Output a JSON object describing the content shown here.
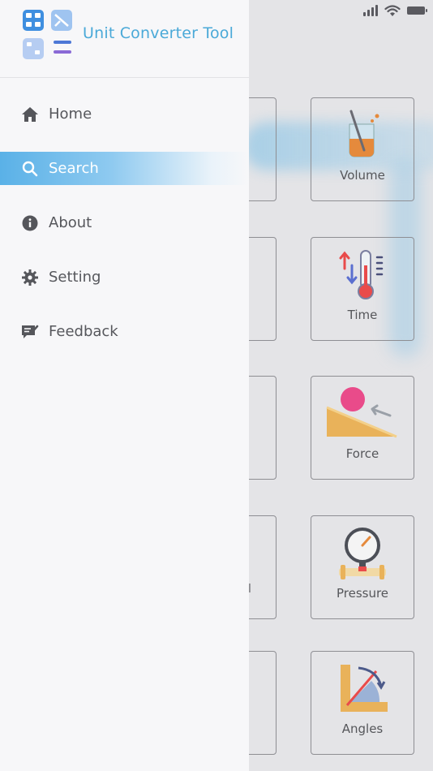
{
  "app": {
    "title": "Unit Converter Tool",
    "accent_color": "#4aa9d8",
    "logo_icon": "app-grid-logo-icon"
  },
  "menu": {
    "items": [
      {
        "id": "home",
        "label": "Home",
        "icon": "home-icon",
        "active": false
      },
      {
        "id": "search",
        "label": "Search",
        "icon": "search-icon",
        "active": true
      },
      {
        "id": "about",
        "label": "About",
        "icon": "info-icon",
        "active": false
      },
      {
        "id": "setting",
        "label": "Setting",
        "icon": "gear-icon",
        "active": false
      },
      {
        "id": "feedback",
        "label": "Feedback",
        "icon": "feedback-icon",
        "active": false
      }
    ],
    "active_gradient_start": "#5ab1e7"
  },
  "background": {
    "tiles": [
      {
        "label": "Volume",
        "icon": "beaker-icon"
      },
      {
        "label": "Time",
        "icon": "thermometer-icon"
      },
      {
        "label": "Force",
        "icon": "ball-ramp-icon"
      },
      {
        "label": "Pressure",
        "icon": "pressure-gauge-icon"
      },
      {
        "label": "Angles",
        "icon": "protractor-icon"
      }
    ],
    "partial_tile_text": "l"
  }
}
